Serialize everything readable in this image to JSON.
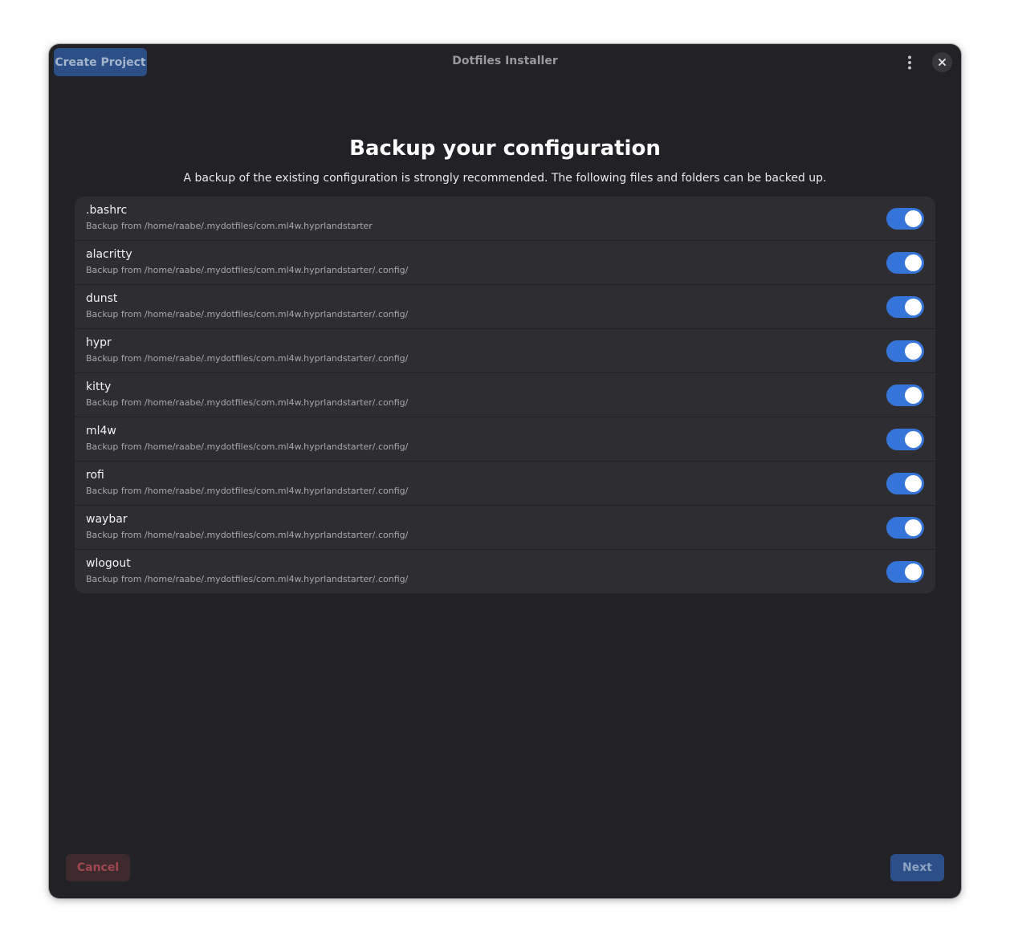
{
  "window": {
    "title": "Dotfiles Installer",
    "create_project_label": "Create Project"
  },
  "page": {
    "heading": "Backup your configuration",
    "subtitle": "A backup of the existing configuration is strongly recommended. The following files and folders can be backed up."
  },
  "items": [
    {
      "name": ".bashrc",
      "path": "Backup from /home/raabe/.mydotfiles/com.ml4w.hyprlandstarter",
      "enabled": true
    },
    {
      "name": "alacritty",
      "path": "Backup from /home/raabe/.mydotfiles/com.ml4w.hyprlandstarter/.config/",
      "enabled": true
    },
    {
      "name": "dunst",
      "path": "Backup from /home/raabe/.mydotfiles/com.ml4w.hyprlandstarter/.config/",
      "enabled": true
    },
    {
      "name": "hypr",
      "path": "Backup from /home/raabe/.mydotfiles/com.ml4w.hyprlandstarter/.config/",
      "enabled": true
    },
    {
      "name": "kitty",
      "path": "Backup from /home/raabe/.mydotfiles/com.ml4w.hyprlandstarter/.config/",
      "enabled": true
    },
    {
      "name": "ml4w",
      "path": "Backup from /home/raabe/.mydotfiles/com.ml4w.hyprlandstarter/.config/",
      "enabled": true
    },
    {
      "name": "rofi",
      "path": "Backup from /home/raabe/.mydotfiles/com.ml4w.hyprlandstarter/.config/",
      "enabled": true
    },
    {
      "name": "waybar",
      "path": "Backup from /home/raabe/.mydotfiles/com.ml4w.hyprlandstarter/.config/",
      "enabled": true
    },
    {
      "name": "wlogout",
      "path": "Backup from /home/raabe/.mydotfiles/com.ml4w.hyprlandstarter/.config/",
      "enabled": true
    }
  ],
  "footer": {
    "cancel_label": "Cancel",
    "next_label": "Next"
  },
  "icons": {
    "menu": "vertical-ellipsis-icon",
    "close": "close-icon"
  },
  "colors": {
    "window_bg": "#222226",
    "list_bg": "#2e2e32",
    "accent": "#3574d8",
    "create_button": "#2b4f86",
    "cancel_bg": "#3d2a2d",
    "cancel_text": "#a0474f"
  }
}
